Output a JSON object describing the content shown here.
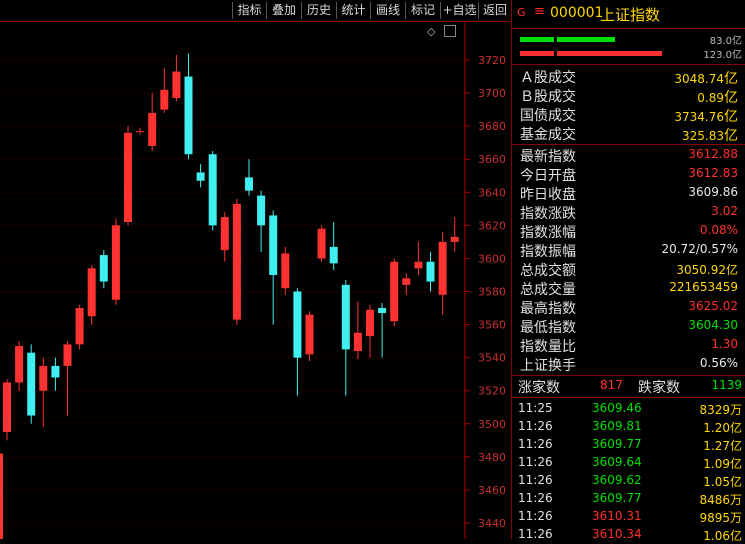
{
  "toolbar": {
    "items": [
      "指标",
      "叠加",
      "历史",
      "统计",
      "画线",
      "标记",
      "+自选",
      "返回"
    ]
  },
  "header": {
    "g_label": "G",
    "menu_icon": "menu-icon",
    "code": "000001",
    "name": "上证指数"
  },
  "bars": {
    "up_amount": "83.0亿",
    "down_amount": "123.0亿",
    "up_color": "#00e000",
    "down_color": "#ff3030"
  },
  "turnover": [
    {
      "label": "Ａ股成交",
      "num": "3048.74",
      "unit": "亿"
    },
    {
      "label": "Ｂ股成交",
      "num": "0.89",
      "unit": "亿"
    },
    {
      "label": "国债成交",
      "num": "3734.76",
      "unit": "亿"
    },
    {
      "label": "基金成交",
      "num": "325.83",
      "unit": "亿"
    }
  ],
  "stats": [
    {
      "label": "最新指数",
      "value": "3612.88",
      "color": "r"
    },
    {
      "label": "今日开盘",
      "value": "3612.83",
      "color": "r"
    },
    {
      "label": "昨日收盘",
      "value": "3609.86",
      "color": "w"
    },
    {
      "label": "指数涨跌",
      "value": "3.02",
      "color": "r"
    },
    {
      "label": "指数涨幅",
      "value": "0.08%",
      "color": "r"
    },
    {
      "label": "指数振幅",
      "value": "20.72/0.57%",
      "color": "w"
    },
    {
      "label": "总成交额",
      "value": "3050.92亿",
      "color": "y"
    },
    {
      "label": "总成交量",
      "value": "221653459",
      "color": "y"
    },
    {
      "label": "最高指数",
      "value": "3625.02",
      "color": "r"
    },
    {
      "label": "最低指数",
      "value": "3604.30",
      "color": "gr"
    },
    {
      "label": "指数量比",
      "value": "1.30",
      "color": "r"
    },
    {
      "label": "上证换手",
      "value": "0.56%",
      "color": "w"
    }
  ],
  "advance_decline": {
    "up_label": "涨家数",
    "up_count": "817",
    "down_label": "跌家数",
    "down_count": "1139"
  },
  "ticks": [
    {
      "time": "11:25",
      "price": "3609.46",
      "vol": "8329万",
      "color": "gr"
    },
    {
      "time": "11:26",
      "price": "3609.81",
      "vol": "1.20亿",
      "color": "gr"
    },
    {
      "time": "11:26",
      "price": "3609.77",
      "vol": "1.27亿",
      "color": "gr"
    },
    {
      "time": "11:26",
      "price": "3609.64",
      "vol": "1.09亿",
      "color": "gr"
    },
    {
      "time": "11:26",
      "price": "3609.62",
      "vol": "1.05亿",
      "color": "gr"
    },
    {
      "time": "11:26",
      "price": "3609.77",
      "vol": "8486万",
      "color": "gr"
    },
    {
      "time": "11:26",
      "price": "3610.31",
      "vol": "9895万",
      "color": "r"
    },
    {
      "time": "11:26",
      "price": "3610.34",
      "vol": "1.06亿",
      "color": "r"
    }
  ],
  "chart_data": {
    "type": "candlestick",
    "y_ticks": [
      3440,
      3460,
      3480,
      3500,
      3520,
      3540,
      3560,
      3580,
      3600,
      3620,
      3640,
      3660,
      3680,
      3700,
      3720
    ],
    "ylim": [
      3430,
      3730
    ],
    "up_color": "#ff3232",
    "down_color": "#40f0f0",
    "candles": [
      {
        "o": 3495,
        "c": 3525,
        "h": 3527,
        "l": 3490
      },
      {
        "o": 3525,
        "c": 3547,
        "h": 3550,
        "l": 3520
      },
      {
        "o": 3543,
        "c": 3505,
        "h": 3548,
        "l": 3500
      },
      {
        "o": 3520,
        "c": 3535,
        "h": 3540,
        "l": 3498
      },
      {
        "o": 3535,
        "c": 3528,
        "h": 3540,
        "l": 3520
      },
      {
        "o": 3535,
        "c": 3548,
        "h": 3550,
        "l": 3505
      },
      {
        "o": 3548,
        "c": 3570,
        "h": 3572,
        "l": 3545
      },
      {
        "o": 3565,
        "c": 3594,
        "h": 3596,
        "l": 3560
      },
      {
        "o": 3602,
        "c": 3586,
        "h": 3605,
        "l": 3582
      },
      {
        "o": 3575,
        "c": 3620,
        "h": 3624,
        "l": 3572
      },
      {
        "o": 3622,
        "c": 3676,
        "h": 3680,
        "l": 3620
      },
      {
        "o": 3677,
        "c": 3677,
        "h": 3679,
        "l": 3675
      },
      {
        "o": 3668,
        "c": 3688,
        "h": 3700,
        "l": 3665
      },
      {
        "o": 3690,
        "c": 3702,
        "h": 3715,
        "l": 3688
      },
      {
        "o": 3697,
        "c": 3713,
        "h": 3723,
        "l": 3695
      },
      {
        "o": 3710,
        "c": 3663,
        "h": 3724,
        "l": 3660
      },
      {
        "o": 3652,
        "c": 3647,
        "h": 3657,
        "l": 3643
      },
      {
        "o": 3663,
        "c": 3620,
        "h": 3665,
        "l": 3617
      },
      {
        "o": 3605,
        "c": 3625,
        "h": 3628,
        "l": 3598
      },
      {
        "o": 3563,
        "c": 3633,
        "h": 3636,
        "l": 3560
      },
      {
        "o": 3649,
        "c": 3641,
        "h": 3660,
        "l": 3638
      },
      {
        "o": 3638,
        "c": 3620,
        "h": 3641,
        "l": 3604
      },
      {
        "o": 3626,
        "c": 3590,
        "h": 3629,
        "l": 3560
      },
      {
        "o": 3582,
        "c": 3603,
        "h": 3607,
        "l": 3578
      },
      {
        "o": 3580,
        "c": 3540,
        "h": 3582,
        "l": 3517
      },
      {
        "o": 3542,
        "c": 3566,
        "h": 3568,
        "l": 3538
      },
      {
        "o": 3600,
        "c": 3618,
        "h": 3620,
        "l": 3598
      },
      {
        "o": 3607,
        "c": 3597,
        "h": 3622,
        "l": 3593
      },
      {
        "o": 3584,
        "c": 3545,
        "h": 3587,
        "l": 3517
      },
      {
        "o": 3544,
        "c": 3555,
        "h": 3574,
        "l": 3539
      },
      {
        "o": 3553,
        "c": 3569,
        "h": 3572,
        "l": 3540
      },
      {
        "o": 3570,
        "c": 3567,
        "h": 3573,
        "l": 3540
      },
      {
        "o": 3562,
        "c": 3598,
        "h": 3600,
        "l": 3559
      },
      {
        "o": 3584,
        "c": 3588,
        "h": 3591,
        "l": 3578
      },
      {
        "o": 3594,
        "c": 3598,
        "h": 3610,
        "l": 3590
      },
      {
        "o": 3598,
        "c": 3586,
        "h": 3604,
        "l": 3580
      },
      {
        "o": 3578,
        "c": 3610,
        "h": 3616,
        "l": 3566
      },
      {
        "o": 3610,
        "c": 3613,
        "h": 3625,
        "l": 3604
      }
    ]
  }
}
